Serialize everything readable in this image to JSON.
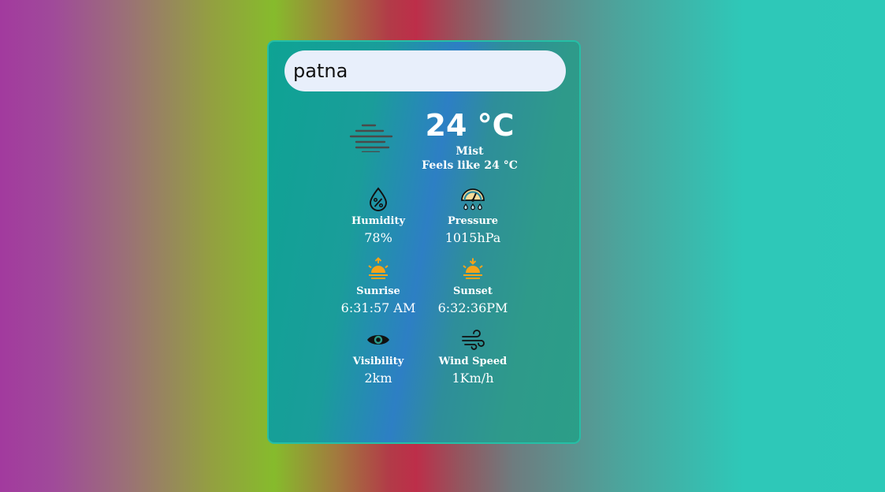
{
  "search": {
    "value": "patna",
    "placeholder": ""
  },
  "weather": {
    "icon": "mist-icon",
    "temperature": "24 °C",
    "condition": "Mist",
    "feels_like": "Feels like 24 °C"
  },
  "stats": [
    {
      "icon": "humidity-icon",
      "label": "Humidity",
      "value": "78%"
    },
    {
      "icon": "pressure-icon",
      "label": "Pressure",
      "value": "1015hPa"
    },
    {
      "icon": "sunrise-icon",
      "label": "Sunrise",
      "value": "6:31:57 AM"
    },
    {
      "icon": "sunset-icon",
      "label": "Sunset",
      "value": "6:32:36PM"
    },
    {
      "icon": "visibility-icon",
      "label": "Visibility",
      "value": "2km"
    },
    {
      "icon": "wind-icon",
      "label": "Wind Speed",
      "value": "1Km/h"
    }
  ],
  "colors": {
    "card_border": "#25bfa6",
    "search_bg": "#e8effb",
    "sun_orange": "#f5a31a"
  }
}
